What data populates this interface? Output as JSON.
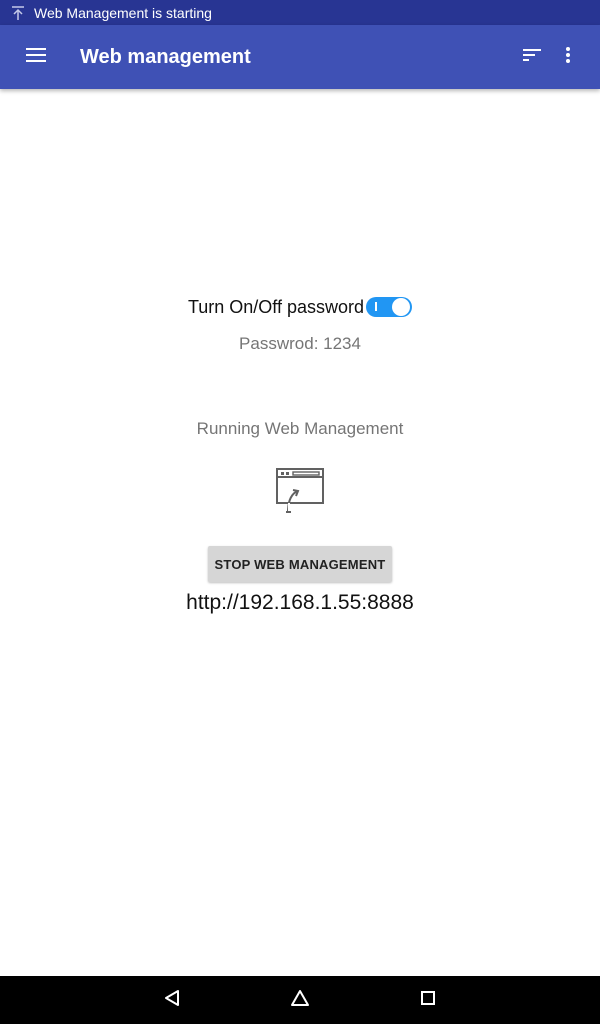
{
  "status_bar": {
    "notification_icon": "upload-arrow-icon",
    "notification_text": "Web Management is starting"
  },
  "app_bar": {
    "menu_icon": "hamburger-menu-icon",
    "title": "Web management",
    "sort_icon": "sort-icon",
    "overflow_icon": "more-vert-icon",
    "background": "#3f51b5"
  },
  "password": {
    "toggle_label": "Turn On/Off password",
    "toggle_on": true,
    "value_text": "Passwrod: 1234"
  },
  "server": {
    "status_text": "Running Web Management",
    "status_icon": "web-share-icon",
    "stop_button_label": "STOP WEB MANAGEMENT",
    "url": "http://192.168.1.55:8888"
  },
  "nav_bar": {
    "back_icon": "back-triangle-icon",
    "home_icon": "home-icon",
    "recents_icon": "recents-square-icon"
  },
  "colors": {
    "status_bar": "#283593",
    "accent": "#2196f3"
  }
}
